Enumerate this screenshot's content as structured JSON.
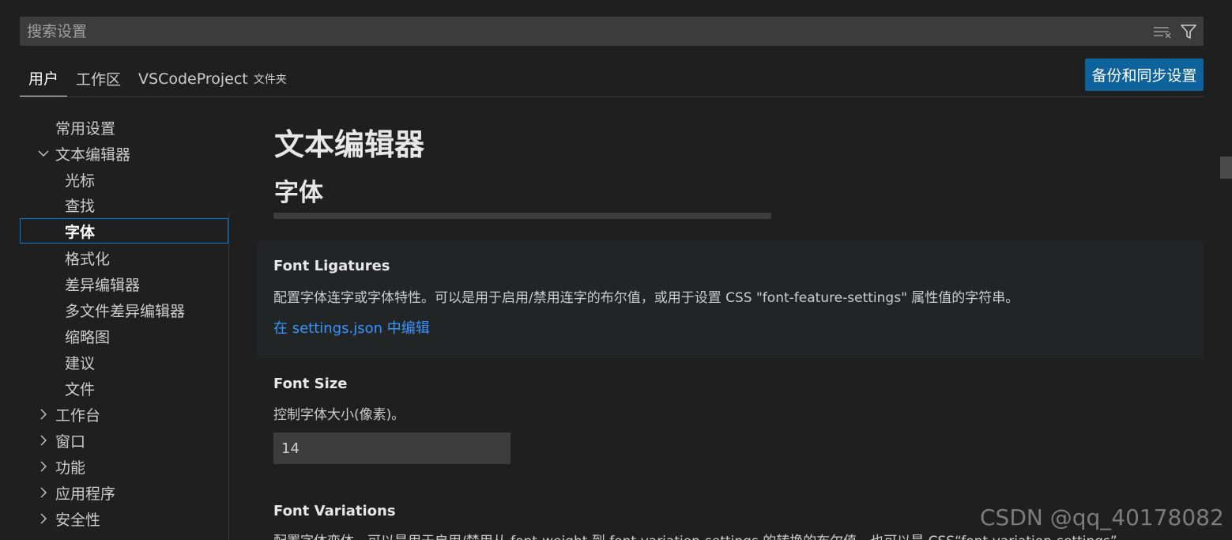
{
  "search": {
    "placeholder": "搜索设置"
  },
  "tabs": [
    {
      "label": "用户"
    },
    {
      "label": "工作区"
    },
    {
      "label": "VSCodeProject",
      "suffix": "文件夹"
    }
  ],
  "sync_button": "备份和同步设置",
  "sidebar": {
    "items": [
      {
        "label": "常用设置"
      },
      {
        "label": "文本编辑器"
      },
      {
        "label": "光标"
      },
      {
        "label": "查找"
      },
      {
        "label": "字体"
      },
      {
        "label": "格式化"
      },
      {
        "label": "差异编辑器"
      },
      {
        "label": "多文件差异编辑器"
      },
      {
        "label": "缩略图"
      },
      {
        "label": "建议"
      },
      {
        "label": "文件"
      },
      {
        "label": "工作台"
      },
      {
        "label": "窗口"
      },
      {
        "label": "功能"
      },
      {
        "label": "应用程序"
      },
      {
        "label": "安全性"
      }
    ]
  },
  "content": {
    "section_title": "文本编辑器",
    "subsection_title": "字体",
    "settings": [
      {
        "title": "Font Ligatures",
        "description": "配置字体连字或字体特性。可以是用于启用/禁用连字的布尔值，或用于设置 CSS \"font-feature-settings\" 属性值的字符串。",
        "link": "在 settings.json 中编辑"
      },
      {
        "title": "Font Size",
        "description": "控制字体大小(像素)。",
        "value": "14"
      },
      {
        "title": "Font Variations",
        "description": "配置字体变体。可以是用于启用/禁用从 font-weight 到 font-variation-settings 的转换的布尔值，也可以是 CSS“font-variation-settings”"
      }
    ]
  },
  "watermark": "CSDN @qq_40178082"
}
